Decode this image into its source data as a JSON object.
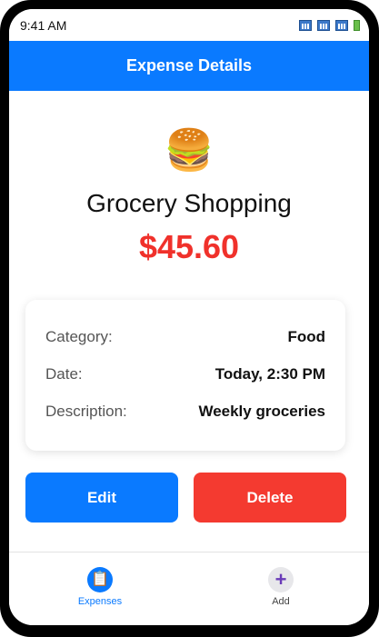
{
  "status_bar": {
    "time": "9:41 AM"
  },
  "header": {
    "title": "Expense Details"
  },
  "expense": {
    "icon": "hamburger-icon",
    "icon_glyph": "🍔",
    "title": "Grocery Shopping",
    "amount": "$45.60",
    "amount_color": "#f0312b"
  },
  "details": [
    {
      "label": "Category:",
      "value": "Food"
    },
    {
      "label": "Date:",
      "value": "Today, 2:30 PM"
    },
    {
      "label": "Description:",
      "value": "Weekly groceries"
    }
  ],
  "actions": {
    "edit_label": "Edit",
    "delete_label": "Delete",
    "edit_color": "#0a7aff",
    "delete_color": "#f43a30"
  },
  "tab_bar": {
    "tabs": [
      {
        "label": "Expenses",
        "icon": "clipboard-icon",
        "glyph": "📋",
        "active": true
      },
      {
        "label": "Add",
        "icon": "plus-icon",
        "glyph": "+",
        "active": false
      }
    ]
  },
  "colors": {
    "accent": "#0a7aff",
    "danger": "#f43a30"
  }
}
